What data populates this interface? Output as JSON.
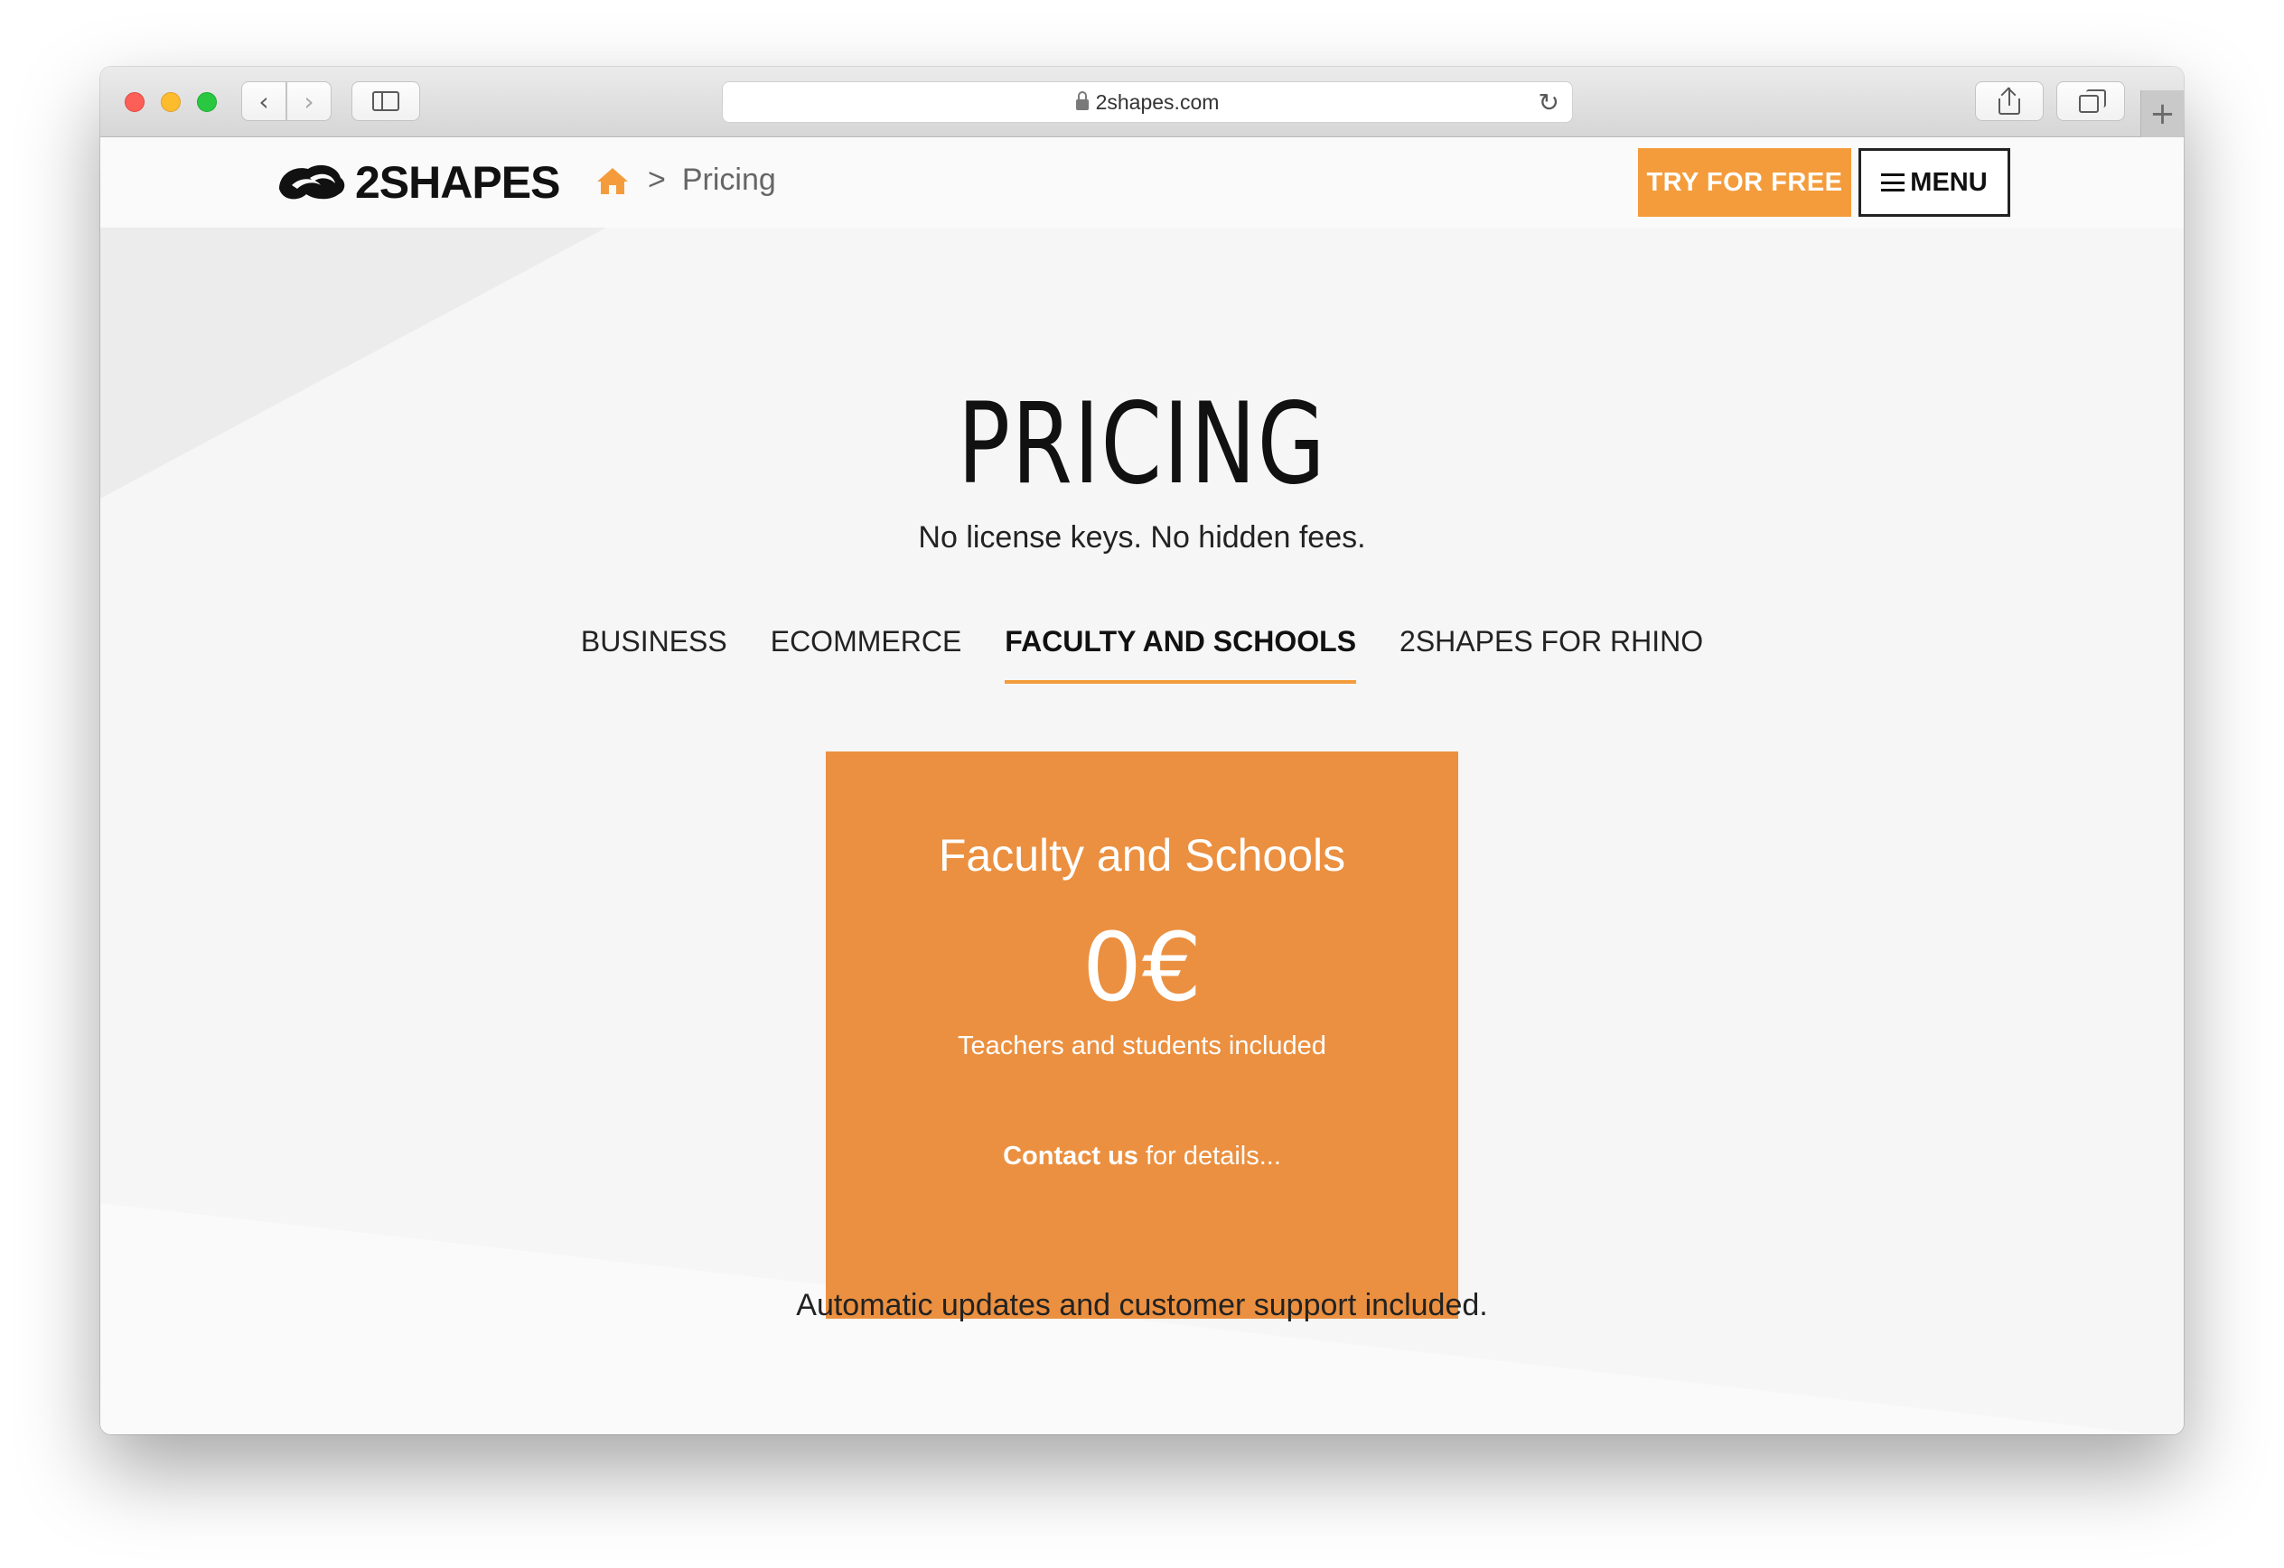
{
  "browser": {
    "url": "2shapes.com",
    "reload_glyph": "↻",
    "back_glyph": "‹",
    "forward_glyph": "›",
    "newtab_glyph": "+"
  },
  "header": {
    "logo_text": "2SHAPES",
    "breadcrumb_separator": ">",
    "breadcrumb_current": "Pricing",
    "try_button": "TRY FOR FREE",
    "menu_button": "MENU",
    "accent_color": "#f49c3c"
  },
  "main": {
    "title": "PRICING",
    "subtitle": "No license keys. No hidden fees.",
    "tabs": [
      {
        "label": "BUSINESS",
        "active": false
      },
      {
        "label": "ECOMMERCE",
        "active": false
      },
      {
        "label": "FACULTY AND SCHOOLS",
        "active": true
      },
      {
        "label": "2SHAPES FOR RHINO",
        "active": false
      }
    ],
    "card": {
      "title": "Faculty and Schools",
      "price": "0€",
      "description": "Teachers and students included",
      "contact_link": "Contact us",
      "contact_suffix": " for details...",
      "color": "#eb9040"
    },
    "footer_note": "Automatic updates and customer support included."
  }
}
